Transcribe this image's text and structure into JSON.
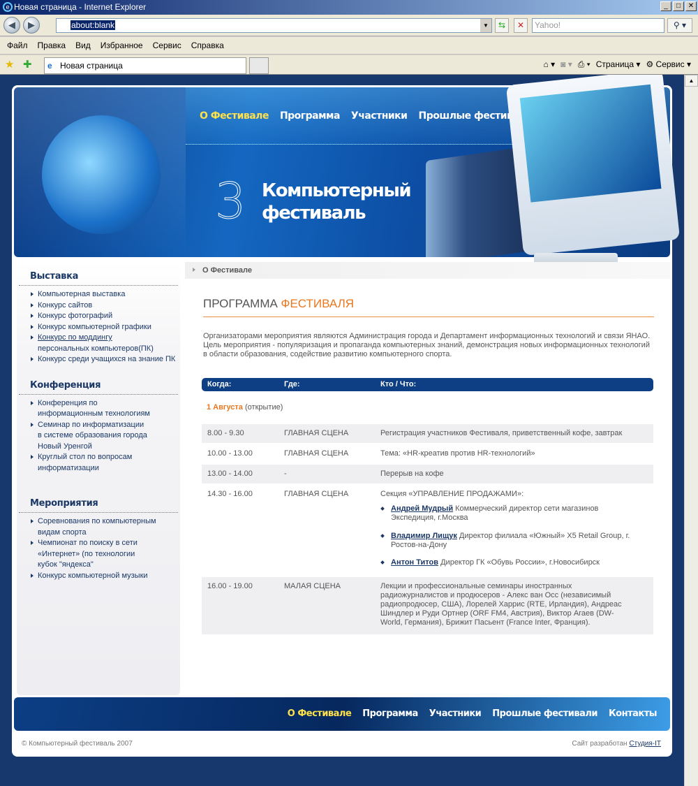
{
  "browser": {
    "title": "Новая страница - Internet Explorer",
    "address": "about:blank",
    "search_placeholder": "Yahoo!",
    "menu": [
      "Файл",
      "Правка",
      "Вид",
      "Избранное",
      "Сервис",
      "Справка"
    ],
    "tab": "Новая страница",
    "cmd_page": "Страница",
    "cmd_tools": "Сервис"
  },
  "nav": [
    "О Фестивале",
    "Программа",
    "Участники",
    "Прошлые фестивали",
    "Контакты"
  ],
  "banner": {
    "number": "3",
    "title_line1": "Компьютерный",
    "title_line2": "фестиваль"
  },
  "sidebar": [
    {
      "title": "Выставка",
      "items": [
        "Компьютерная выставка",
        "Конкурс сайтов",
        "Конкурс фотографий",
        "Конкурс компьютерной графики"
      ],
      "modding_link": "Конкурс по моддингу",
      "modding_rest": "персональных компьютеров(ПК)",
      "last": "Конкурс среди учащихся на знание ПК"
    },
    {
      "title": "Конференция",
      "items": [
        "Конференция по информационным технологиям",
        "Семинар по информатизации в системе образования города Новый Уренгой",
        "Круглый стол по вопросам информатизации"
      ]
    },
    {
      "title": "Мероприятия",
      "items": [
        "Соревнования по компьютерным видам спорта",
        "Чемпионат по поиску в сети «Интернет» (по технологии кубок \"яндекса\"",
        "Конкурс компьютерной музыки"
      ]
    }
  ],
  "breadcrumb": "О Фестивале",
  "heading": {
    "part1": "ПРОГРАММА ",
    "part2": "ФЕСТИВАЛЯ"
  },
  "intro": "Организаторами мероприятия являются Администрация города и Департамент информационных технологий и связи ЯНАО. Цель мероприятия - популяризация и пропаганда компьютерных знаний, демонстрация новых информационных технологий в области образования, содействие развитию компьютерного спорта.",
  "table": {
    "headers": [
      "Когда:",
      "Где:",
      "Кто / Что:"
    ],
    "date": "1 Августа",
    "date_note": " (открытие)",
    "rows": [
      {
        "when": "8.00 - 9.30",
        "where": "ГЛАВНАЯ СЦЕНА",
        "what": "Регистрация участников Фестиваля, приветственный кофе, завтрак"
      },
      {
        "when": "10.00 - 13.00",
        "where": "ГЛАВНАЯ СЦЕНА",
        "what": "Тема: «HR-креатив против HR-технологий»"
      },
      {
        "when": "13.00 - 14.00",
        "where": "-",
        "what": "Перерыв на кофе"
      },
      {
        "when": "14.30 - 16.00",
        "where": "ГЛАВНАЯ СЦЕНА",
        "what": "Секция «УПРАВЛЕНИЕ ПРОДАЖАМИ»:"
      },
      {
        "when": "16.00 - 19.00",
        "where": "МАЛАЯ СЦЕНА",
        "what": "Лекции и профессиональные семинары иностранных радиожурналистов и продюсеров - Алекс ван Осс (независимый радиопродюсер, США), Лорелей Харрис (RTE, Ирландия), Андреас Шиндлер и Руди Ортнер (ORF FM4, Австрия), Виктор Агаев (DW-World, Германия), Брижит Пасьент (France Inter, Франция)."
      }
    ],
    "speakers": [
      {
        "name": "Андрей Мудрый",
        "desc": " Коммерческий директор сети магазинов Экспедиция, г.Москва"
      },
      {
        "name": "Владимир Лищук",
        "desc": " Директор филиала «Южный» X5 Retail Group, г. Ростов-на-Дону"
      },
      {
        "name": "Антон Титов",
        "desc": " Директор ГК «Обувь России», г.Новосибирск"
      }
    ]
  },
  "footer": {
    "copyright": "© Компьютерный фестиваль 2007",
    "dev_text": "Сайт разработан ",
    "dev_link": "Студия-IT"
  }
}
